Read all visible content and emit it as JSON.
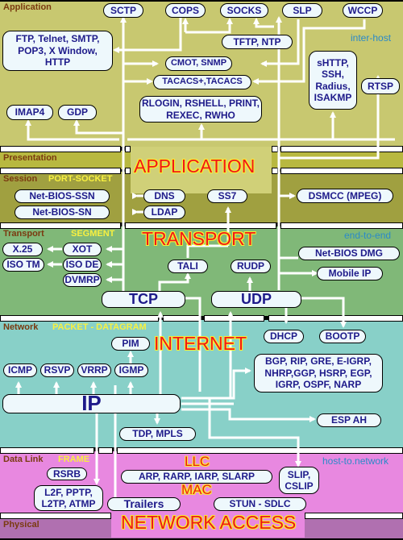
{
  "layers": {
    "application": {
      "label": "Application",
      "color": "#c8c870"
    },
    "presentation": {
      "label": "Presentation",
      "color": "#b8b840"
    },
    "session": {
      "label": "Session",
      "unit": "PORT-SOCKET",
      "color": "#a0a040"
    },
    "transport": {
      "label": "Transport",
      "unit": "SEGMENT",
      "color": "#80b878"
    },
    "network": {
      "label": "Network",
      "unit": "PACKET - DATAGRAM",
      "color": "#88d0c8"
    },
    "datalink": {
      "label": "Data Link",
      "unit": "FRAME",
      "color": "#e888e0"
    },
    "physical": {
      "label": "Physical",
      "color": "#b070b0"
    }
  },
  "scopes": {
    "inter_host": "inter-host",
    "end_to_end": "end-to-end",
    "host_to_network": "host-to.network"
  },
  "tcpip_layers": {
    "application": "APPLICATION",
    "transport": "TRANSPORT",
    "internet": "INTERNET",
    "network_access": "NETWORK ACCESS",
    "llc": "LLC",
    "mac": "MAC"
  },
  "protocols": {
    "sctp": "SCTP",
    "cops": "COPS",
    "socks": "SOCKS",
    "slp": "SLP",
    "wccp": "WCCP",
    "ftp_group": "FTP, Telnet, SMTP, POP3,  X Window, HTTP",
    "tftp_ntp": "TFTP, NTP",
    "cmot_snmp": "CMOT, SNMP",
    "tacacs": "TACACS+,TACACS",
    "shttp_group": "sHTTP, SSH, Radius, ISAKMP",
    "rtsp": "RTSP",
    "rlogin_group": "RLOGIN, RSHELL, PRINT, REXEC, RWHO",
    "imap4": "IMAP4",
    "gdp": "GDP",
    "netbios_ssn": "Net-BIOS-SSN",
    "netbios_sn": "Net-BIOS-SN",
    "dns": "DNS",
    "ldap": "LDAP",
    "ss7": "SS7",
    "dsmcc": "DSMCC (MPEG)",
    "x25": "X.25",
    "xot": "XOT",
    "iso_tm": "ISO TM",
    "iso_de": "ISO DE",
    "dvmrp": "DVMRP",
    "tali": "TALI",
    "rudp": "RUDP",
    "netbios_dmg": "Net-BIOS DMG",
    "mobile_ip": "Mobile IP",
    "tcp": "TCP",
    "udp": "UDP",
    "pim": "PIM",
    "dhcp": "DHCP",
    "bootp": "BOOTP",
    "icmp": "ICMP",
    "rsvp": "RSVP",
    "vrrp": "VRRP",
    "igmp": "IGMP",
    "bgp_group": "BGP, RIP, GRE, E-IGRP, NHRP,GGP, HSRP, EGP, IGRP, OSPF, NARP",
    "ip": "IP",
    "esp_ah": "ESP AH",
    "tdp_mpls": "TDP, MPLS",
    "rsrb": "RSRB",
    "l2f_group": "L2F, PPTP, L2TP, ATMP",
    "arp_group": "ARP, RARP, IARP, SLARP",
    "slip": "SLIP, CSLIP",
    "trailers": "Trailers",
    "stun": "STUN - SDLC"
  }
}
